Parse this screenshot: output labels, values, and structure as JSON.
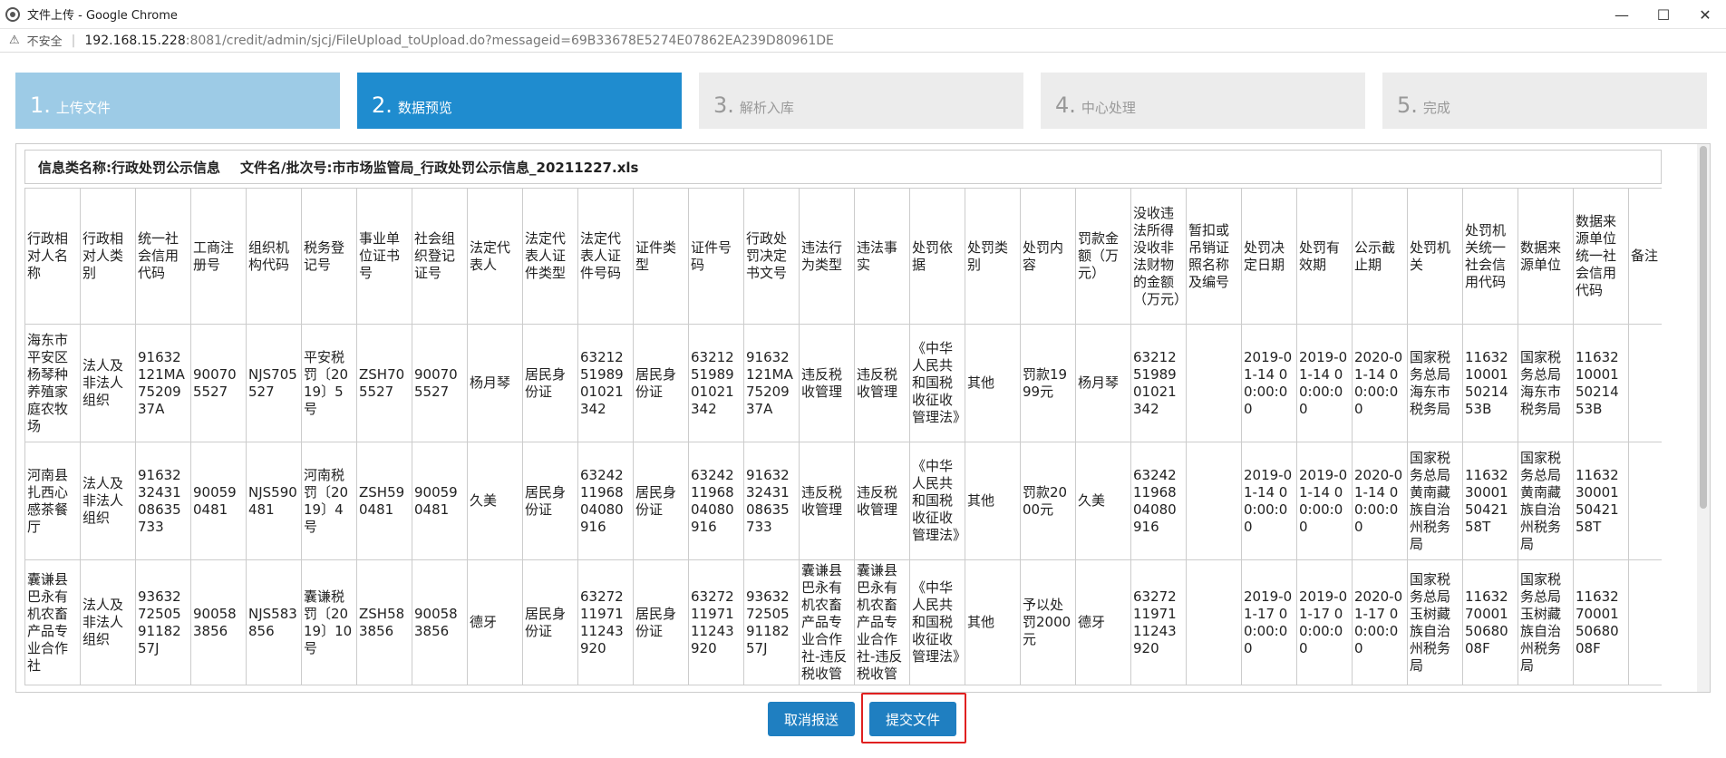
{
  "window": {
    "title": "文件上传 - Google Chrome",
    "controls": {
      "minimize": "—",
      "maximize": "☐",
      "close": "✕"
    }
  },
  "address": {
    "insecure_label": "不安全",
    "host": "192.168.15.228",
    "path": ":8081/credit/admin/sjcj/FileUpload_toUpload.do?messageid=69B33678E5274E07862EA239D80961DE"
  },
  "steps": [
    {
      "num": "1.",
      "label": "上传文件",
      "state": "done"
    },
    {
      "num": "2.",
      "label": "数据预览",
      "state": "active"
    },
    {
      "num": "3.",
      "label": "解析入库",
      "state": "todo"
    },
    {
      "num": "4.",
      "label": "中心处理",
      "state": "todo"
    },
    {
      "num": "5.",
      "label": "完成",
      "state": "todo"
    }
  ],
  "info": {
    "category_label": "信息类名称:",
    "category_value": "行政处罚公示信息",
    "file_label": "文件名/批次号:",
    "file_value": "市市场监管局_行政处罚公示信息_20211227.xls"
  },
  "table": {
    "headers": [
      "行政相对人名称",
      "行政相对人类别",
      "统一社会信用代码",
      "工商注册号",
      "组织机构代码",
      "税务登记号",
      "事业单位证书号",
      "社会组织登记证号",
      "法定代表人",
      "法定代表人证件类型",
      "法定代表人证件号码",
      "证件类型",
      "证件号码",
      "行政处罚决定书文号",
      "违法行为类型",
      "违法事实",
      "处罚依据",
      "处罚类别",
      "处罚内容",
      "罚款金额（万元）",
      "没收违法所得没收非法财物的金额（万元）",
      "暂扣或吊销证照名称及编号",
      "处罚决定日期",
      "处罚有效期",
      "公示截止期",
      "处罚机关",
      "处罚机关统一社会信用代码",
      "数据来源单位",
      "数据来源单位统一社会信用代码",
      "备注"
    ],
    "rows": [
      [
        "海东市平安区杨琴种养殖家庭农牧场",
        "法人及非法人组织",
        "91632121MA7520937A",
        "900705527",
        "NJS705527",
        "平安税罚〔2019〕5号",
        "ZSH705527",
        "900705527",
        "杨月琴",
        "居民身份证",
        "632125198901021342",
        "居民身份证",
        "632125198901021342",
        "91632121MA7520937A",
        "违反税收管理",
        "违反税收管理",
        "《中华人民共和国税收征收管理法》",
        "其他",
        "罚款1999元",
        "杨月琴",
        "632125198901021342",
        "",
        "2019-01-14 00:00:00",
        "2019-01-14 00:00:00",
        "2020-01-14 00:00:00",
        "国家税务总局海东市税务局",
        "11632100015021453B",
        "国家税务总局海东市税务局",
        "11632100015021453B",
        ""
      ],
      [
        "河南县扎西心感茶餐厅",
        "法人及非法人组织",
        "916323243108635733",
        "900590481",
        "NJS590481",
        "河南税罚〔2019〕4号",
        "ZSH590481",
        "900590481",
        "久美",
        "居民身份证",
        "632421196804080916",
        "居民身份证",
        "632421196804080916",
        "916323243108635733",
        "违反税收管理",
        "违反税收管理",
        "《中华人民共和国税收征收管理法》",
        "其他",
        "罚款2000元",
        "久美",
        "632421196804080916",
        "",
        "2019-01-14 00:00:00",
        "2019-01-14 00:00:00",
        "2020-01-14 00:00:00",
        "国家税务总局黄南藏族自治州税务局",
        "11632300015042158T",
        "国家税务总局黄南藏族自治州税务局",
        "11632300015042158T",
        ""
      ],
      [
        "囊谦县巴永有机农畜产品专业合作社",
        "法人及非法人组织",
        "93632725059118257J",
        "900583856",
        "NJS583856",
        "囊谦税罚〔2019〕10号",
        "ZSH583856",
        "900583856",
        "德牙",
        "居民身份证",
        "632721197111243920",
        "居民身份证",
        "632721197111243920",
        "93632725059118257J",
        "囊谦县巴永有机农畜产品专业合作社-违反税收管",
        "囊谦县巴永有机农畜产品专业合作社-违反税收管",
        "《中华人民共和国税收征收管理法》",
        "其他",
        "予以处罚2000元",
        "德牙",
        "632721197111243920",
        "",
        "2019-01-17 00:00:00",
        "2019-01-17 00:00:00",
        "2020-01-17 00:00:00",
        "国家税务总局玉树藏族自治州税务局",
        "11632700015068008F",
        "国家税务总局玉树藏族自治州税务局",
        "11632700015068008F",
        ""
      ]
    ]
  },
  "buttons": {
    "cancel": "取消报送",
    "submit": "提交文件"
  }
}
